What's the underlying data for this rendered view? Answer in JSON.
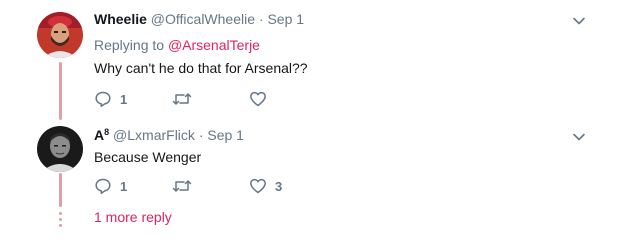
{
  "tweets": [
    {
      "author_name": "Wheelie",
      "handle": "@OfficalWheelie",
      "separator": "·",
      "date": "Sep 1",
      "replying_prefix": "Replying to",
      "replying_to": "@ArsenalTerje",
      "text": "Why can't he do that for Arsenal??",
      "reply_count": "1",
      "retweet_count": "",
      "like_count": ""
    },
    {
      "author_name": "A",
      "author_superscript": "8",
      "handle": "@LxmarFlick",
      "separator": "·",
      "date": "Sep 1",
      "text": "Because Wenger",
      "reply_count": "1",
      "retweet_count": "",
      "like_count": "3"
    }
  ],
  "more_replies_link": "1 more reply",
  "icons": [
    "chevron-down-icon",
    "reply-icon",
    "retweet-icon",
    "like-heart-icon"
  ],
  "colors": {
    "accent": "#e0245e",
    "thread_line": "#e1a0a7",
    "muted_text": "#657786",
    "primary_text": "#14171a"
  }
}
